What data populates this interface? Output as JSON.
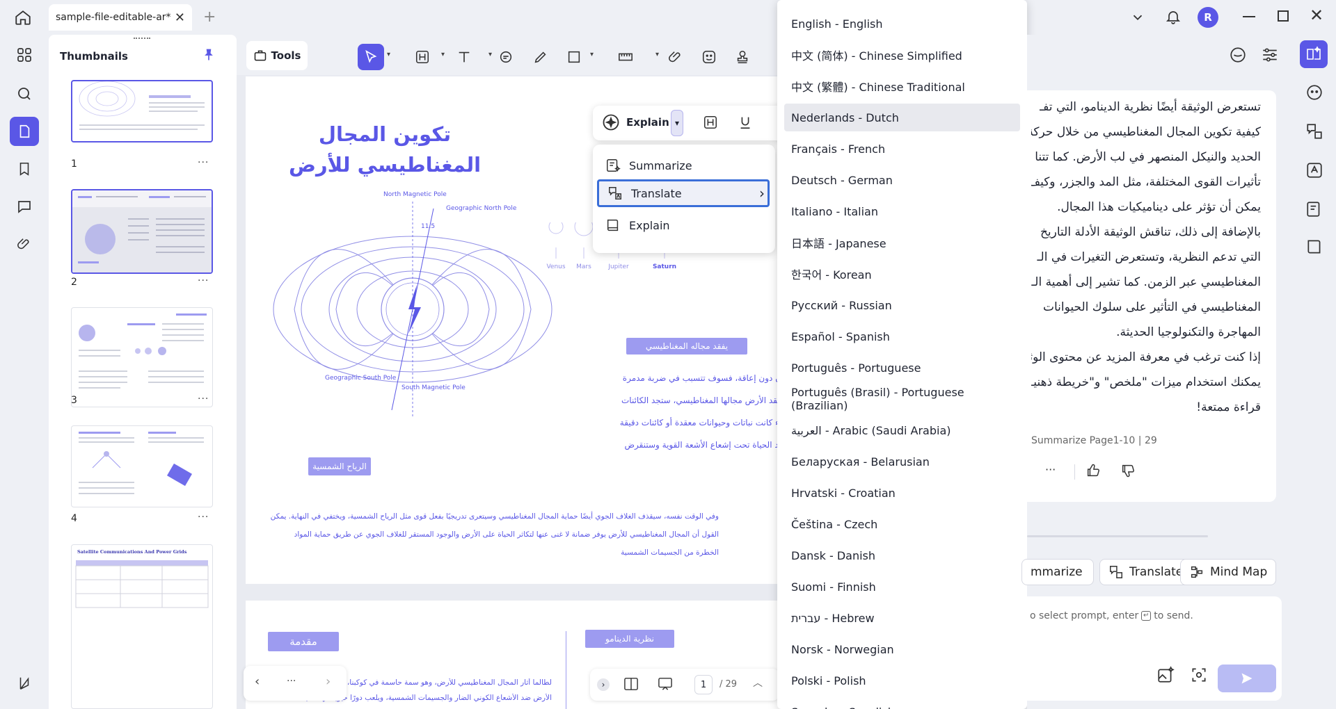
{
  "tab": {
    "title": "sample-file-editable-ar*",
    "close": "✕",
    "add": "+"
  },
  "user": {
    "initial": "R"
  },
  "thumbnails": {
    "title": "Thumbnails",
    "pages": [
      {
        "num": "1",
        "more": "···"
      },
      {
        "num": "2",
        "more": "···"
      },
      {
        "num": "3",
        "more": "···"
      },
      {
        "num": "4",
        "more": "···"
      }
    ],
    "page5_heading": "Satellite Communications And Power Grids"
  },
  "toolbar": {
    "tools_label": "Tools"
  },
  "document": {
    "title_line1": "تكوين المجال",
    "title_line2": "المغناطيسي للأرض",
    "north_magnetic_pole": "North Magnetic Pole",
    "geographic_north_pole": "Geographic North Pole",
    "geographic_south_pole": "Geographic South Pole",
    "south_magnetic_pole": "South Magnetic Pole",
    "angle": "11.5",
    "planets": [
      "Venus",
      "Mars",
      "Jupiter",
      "Saturn"
    ],
    "pill_lose_field": "يفقد مجاله المغناطيسي",
    "pill_solar_wind": "الرياح الشمسية",
    "lose_field_lines": [
      "ن دون إعاقة، فسوف تتسبب في ضربة مدمرة",
      "فقد الأرض مجالها المغناطيسي، ستجد الكائنات",
      "اء كانت نباتات وحيوانات معقدة أو كائنات دقيقة",
      "يد الحياة تحت إشعاع الأشعة القوية وستنقرض"
    ],
    "bottom_lines": [
      "وفي الوقت نفسه، سيقذف الغلاف الجوي أيضًا حماية المجال المغناطيسي وسيتعرى تدريجيًا بفعل قوى مثل الرياح الشمسية، ويختفي في النهاية. يمكن",
      "القول أن المجال المغناطيسي للأرض يوفر ضمانة لا غنى عنها لتكاثر الحياة على الأرض والوجود المستقر للغلاف الجوي عن طريق حماية المواد",
      "الخطرة من الجسيمات الشمسية"
    ],
    "page2_pill_intro": "مقدمة",
    "page2_pill_dynamo": "نظرية الدينامو",
    "page2_line1": "لطالما أثار المجال المغناطيسي للأرض، وهو سمة حاسمة في كوكبنا، فضول الـ",
    "page2_line2": "الأرض ضد الأشعاع الكوني الضار والجسيمات الشمسية، ويلعب دورًا حيويًا في حماية الغلاف الأرض"
  },
  "explain_bar": {
    "label": "Explain",
    "chevron": "⌄"
  },
  "context_menu": {
    "items": [
      {
        "label": "Summarize"
      },
      {
        "label": "Translate",
        "arrow": "›"
      },
      {
        "label": "Explain"
      }
    ]
  },
  "languages": [
    "English - English",
    "中文 (简体) - Chinese Simplified",
    "中文 (繁體) - Chinese Traditional",
    "Nederlands - Dutch",
    "Français - French",
    "Deutsch - German",
    "Italiano - Italian",
    "日本語 - Japanese",
    "한국어 - Korean",
    "Русский - Russian",
    "Español - Spanish",
    "Português - Portuguese",
    "Português (Brasil) - Portuguese (Brazilian)",
    "العربية - Arabic (Saudi Arabia)",
    "Беларуская - Belarusian",
    "Hrvatski - Croatian",
    "Čeština - Czech",
    "Dansk - Danish",
    "Suomi - Finnish",
    "עברית - Hebrew",
    "Norsk - Norwegian",
    "Polski - Polish",
    "Svenska - Swedish"
  ],
  "languages_hovered": "Nederlands - Dutch",
  "ai_panel": {
    "lines": [
      "تستعرض الوثيقة أيضًا نظرية الدينامو، التي تفـ",
      "كيفية تكوين المجال المغناطيسي من خلال حركة",
      "الحديد والنيكل المنصهر في لب الأرض. كما تتنا",
      "تأثيرات القوى المختلفة، مثل المد والجزر، وكيف",
      "يمكن أن تؤثر على ديناميكيات هذا المجال.",
      "بالإضافة إلى ذلك، تناقش الوثيقة الأدلة التاريخ",
      "التي تدعم النظرية، وتستعرض التغيرات في الـ",
      "المغناطيسي عبر الزمن. كما تشير إلى أهمية الـ",
      "المغناطيسي في التأثير على سلوك الحيوانات",
      "المهاجرة والتكنولوجيا الحديثة.",
      "إذا كنت ترغب في معرفة المزيد عن محتوى الوثـ",
      "يمكنك استخدام ميزات \"ملخص\" و\"خريطة ذهنيـ",
      "قراءة ممتعة!"
    ],
    "source": "Summarize Page1-10 | 29",
    "more": "···",
    "btn_summarize": "mmarize",
    "btn_translate": "Translate",
    "btn_mindmap": "Mind Map",
    "prompt_hint_1": "o select prompt, enter",
    "prompt_hint_2": "to send."
  },
  "page_nav": {
    "current": "1",
    "total": "/ 29",
    "dots": "···"
  },
  "colors": {
    "accent": "#5a57e6",
    "selection": "#3a6ed8"
  }
}
